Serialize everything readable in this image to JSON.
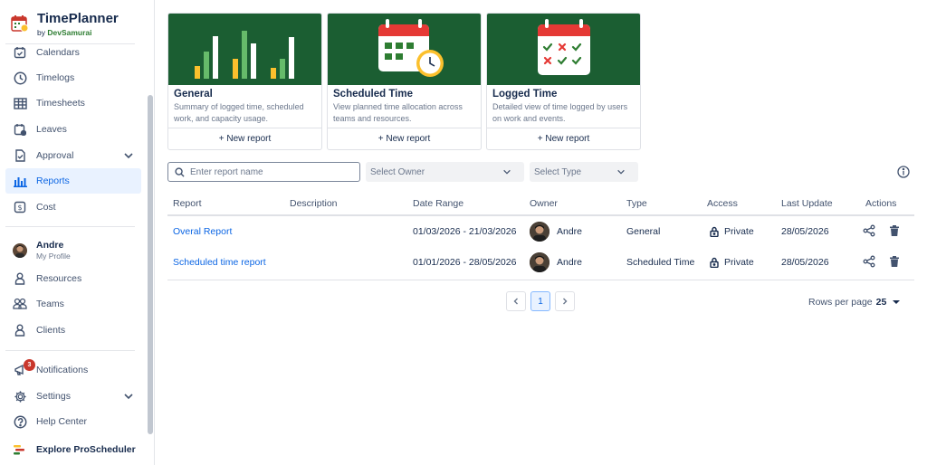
{
  "brand": {
    "title": "TimePlanner",
    "by": "by",
    "company": "DevSamurai"
  },
  "sidebar": {
    "items": [
      {
        "label": "Calendars",
        "icon": "calendar-check-icon"
      },
      {
        "label": "Timelogs",
        "icon": "clock-icon"
      },
      {
        "label": "Timesheets",
        "icon": "table-grid-icon"
      },
      {
        "label": "Leaves",
        "icon": "calendar-leave-icon"
      },
      {
        "label": "Approval",
        "icon": "approval-doc-icon"
      },
      {
        "label": "Reports",
        "icon": "bar-chart-icon"
      },
      {
        "label": "Cost",
        "icon": "money-icon"
      }
    ],
    "profile": {
      "name": "Andre",
      "sub": "My Profile"
    },
    "people": [
      {
        "label": "Resources",
        "icon": "person-icon"
      },
      {
        "label": "Teams",
        "icon": "team-icon"
      },
      {
        "label": "Clients",
        "icon": "client-icon"
      }
    ],
    "bottom": [
      {
        "label": "Notifications",
        "icon": "megaphone-icon"
      },
      {
        "label": "Settings",
        "icon": "gear-icon"
      },
      {
        "label": "Help Center",
        "icon": "help-icon"
      },
      {
        "label": "Explore ProScheduler",
        "icon": "proscheduler-logo-icon"
      }
    ],
    "notification_count": "3",
    "active": "Reports"
  },
  "cards": [
    {
      "title": "General",
      "desc": "Summary of logged time, scheduled work, and capacity usage.",
      "action": "+ New report"
    },
    {
      "title": "Scheduled Time",
      "desc": "View planned time allocation across teams and resources.",
      "action": "+ New report"
    },
    {
      "title": "Logged Time",
      "desc": "Detailed view of time logged by users on work and events.",
      "action": "+ New report"
    }
  ],
  "filters": {
    "search_placeholder": "Enter report name",
    "owner_placeholder": "Select Owner",
    "type_placeholder": "Select Type"
  },
  "table": {
    "columns": [
      "Report",
      "Description",
      "Date Range",
      "Owner",
      "Type",
      "Access",
      "Last Update",
      "Actions"
    ],
    "rows": [
      {
        "report": "Overal Report",
        "description": "",
        "date_range": "01/03/2026 - 21/03/2026",
        "owner": "Andre",
        "type": "General",
        "access": "Private",
        "last_update": "28/05/2026"
      },
      {
        "report": "Scheduled time report",
        "description": "",
        "date_range": "01/01/2026 - 28/05/2026",
        "owner": "Andre",
        "type": "Scheduled Time",
        "access": "Private",
        "last_update": "28/05/2026"
      }
    ]
  },
  "pagination": {
    "current_page": "1",
    "rows_per_page_label": "Rows per page",
    "rows_per_page": "25"
  },
  "colors": {
    "brand_green": "#1b5e32",
    "accent_blue": "#0c66e4",
    "badge_red": "#c9372c"
  }
}
